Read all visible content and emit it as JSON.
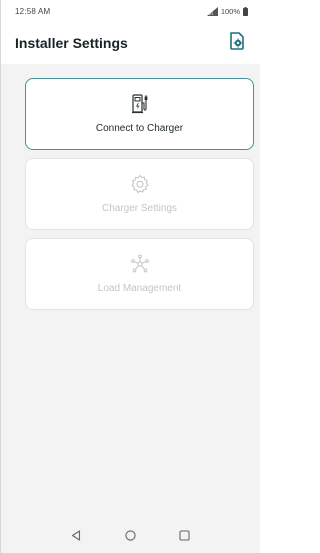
{
  "status_bar": {
    "time": "12:58 AM",
    "battery": "100%"
  },
  "header": {
    "title": "Installer Settings",
    "action_icon": "settings-document-icon"
  },
  "cards": [
    {
      "label": "Connect to Charger",
      "icon": "ev-charger-icon",
      "state": "active"
    },
    {
      "label": "Charger Settings",
      "icon": "gear-icon",
      "state": "disabled"
    },
    {
      "label": "Load Management",
      "icon": "network-nodes-icon",
      "state": "disabled"
    }
  ],
  "colors": {
    "accent": "#1f6f80",
    "active_border": "#4a8f9b",
    "disabled": "#c2c6c8",
    "background": "#f3f3f3"
  },
  "nav_bar": {
    "buttons": [
      "back-icon",
      "home-icon",
      "recents-icon"
    ]
  }
}
